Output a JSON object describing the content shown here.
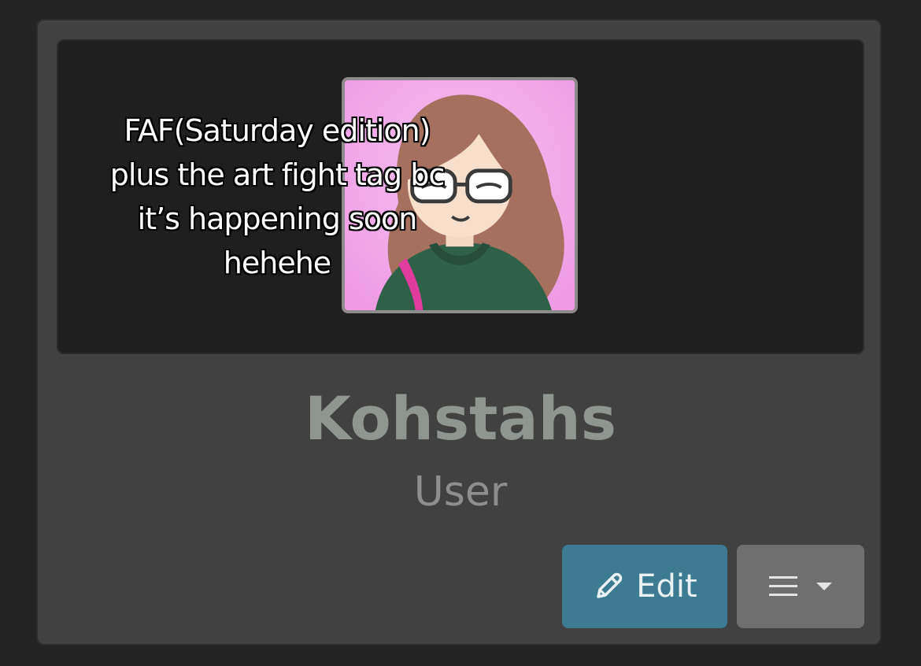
{
  "overlay_caption": {
    "lines": [
      "FAF(Saturday edition)",
      "plus the art fight tag bc",
      "it’s happening soon",
      "hehehe"
    ]
  },
  "profile": {
    "username": "Kohstahs",
    "role": "User"
  },
  "actions": {
    "edit_label": "Edit",
    "edit_icon": "pencil-icon",
    "menu_icon": "hamburger-menu-icon",
    "menu_caret_icon": "caret-down-icon"
  },
  "colors": {
    "background": "#232323",
    "card": "#414141",
    "banner": "#1f1f1f",
    "edit_button": "#3c7b92",
    "menu_button": "#6f6f6f",
    "username_text": "#8f9690"
  }
}
